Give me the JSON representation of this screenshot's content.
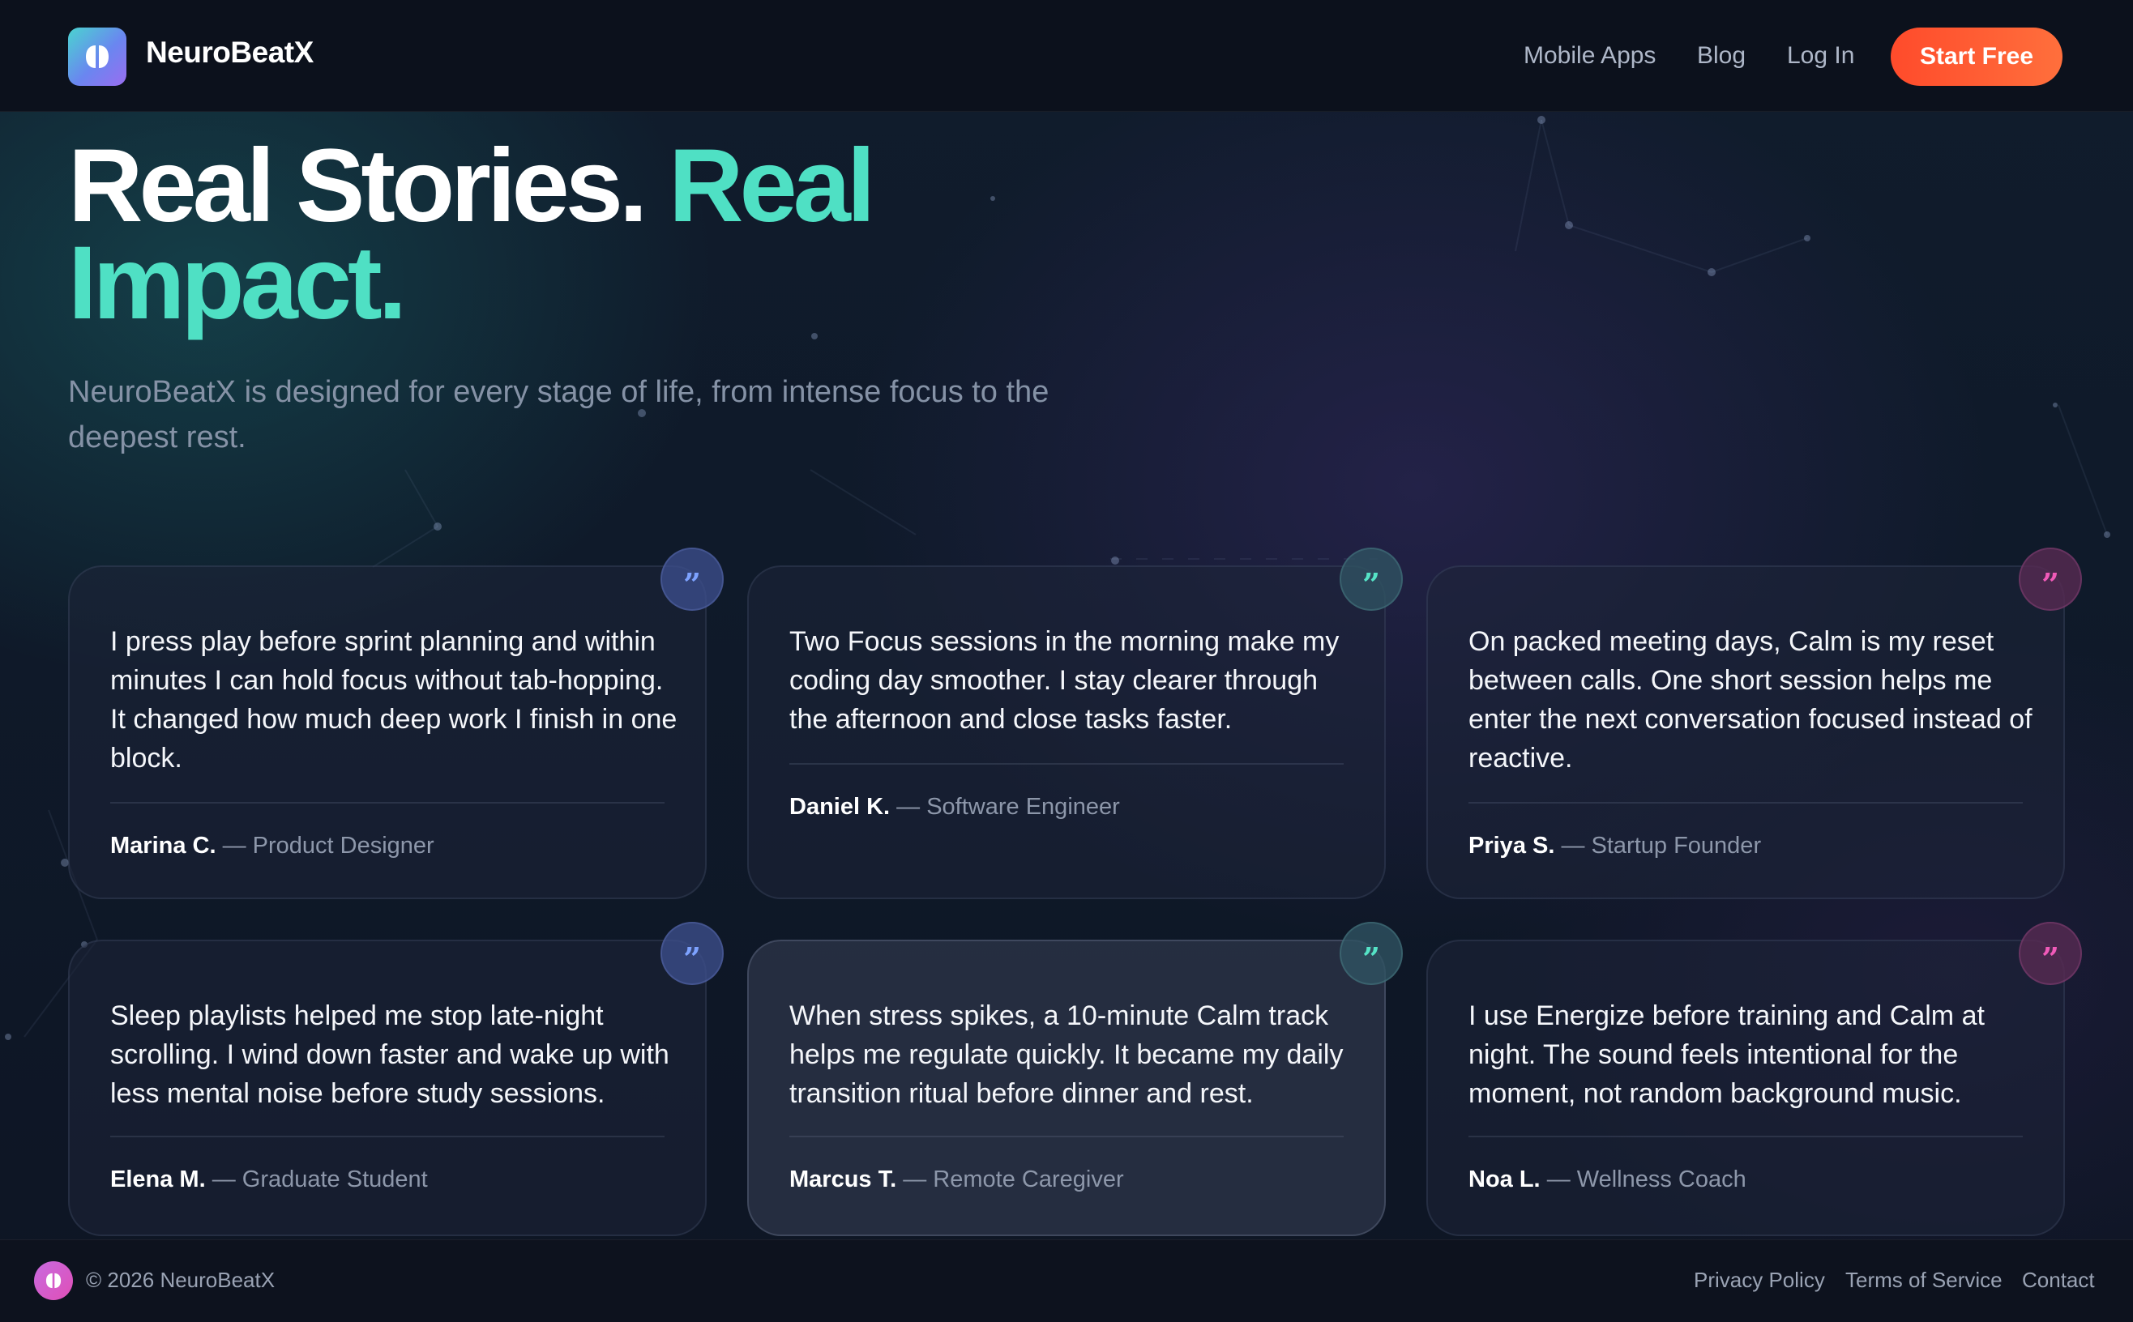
{
  "header": {
    "brand": "NeuroBeatX",
    "nav": [
      "Mobile Apps",
      "Blog",
      "Log In"
    ],
    "cta_label": "Start Free"
  },
  "hero": {
    "title_white": "Real Stories.",
    "title_accent_1": "Real",
    "title_accent_2": "Impact.",
    "subtitle": "NeuroBeatX is designed for every stage of life, from intense focus to the deepest rest."
  },
  "testimonials": [
    {
      "quote": "I press play before sprint planning and within minutes I can hold focus without tab-hopping. It changed how much deep work I finish in one block.",
      "name": "Marina C.",
      "role": "— Product Designer",
      "badge_icon": "quote-icon",
      "badge_color": "#7da2ff"
    },
    {
      "quote": "Two Focus sessions in the morning make my coding day smoother. I stay clearer through the afternoon and close tasks faster.",
      "name": "Daniel K.",
      "role": "— Software Engineer",
      "badge_icon": "quote-icon",
      "badge_color": "#55e3c6"
    },
    {
      "quote": "On packed meeting days, Calm is my reset between calls. One short session helps me enter the next conversation focused instead of reactive.",
      "name": "Priya S.",
      "role": "— Startup Founder",
      "badge_icon": "quote-icon",
      "badge_color": "#f05ab8"
    },
    {
      "quote": "Sleep playlists helped me stop late-night scrolling. I wind down faster and wake up with less mental noise before study sessions.",
      "name": "Elena M.",
      "role": "— Graduate Student",
      "badge_icon": "quote-icon",
      "badge_color": "#7da2ff"
    },
    {
      "quote": "When stress spikes, a 10-minute Calm track helps me regulate quickly. It became my daily transition ritual before dinner and rest.",
      "name": "Marcus T.",
      "role": "— Remote Caregiver",
      "badge_icon": "quote-icon",
      "badge_color": "#55e3c6"
    },
    {
      "quote": "I use Energize before training and Calm at night. The sound feels intentional for the moment, not random background music.",
      "name": "Noa L.",
      "role": "— Wellness Coach",
      "badge_icon": "quote-icon",
      "badge_color": "#f05ab8"
    }
  ],
  "footer": {
    "copyright": "© 2026 NeuroBeatX",
    "links": [
      "Privacy Policy",
      "Terms of Service",
      "Contact"
    ]
  },
  "colors": {
    "accent_teal": "#4fe0c4",
    "cta_orange": "#ff5a30",
    "background": "#0e1424"
  }
}
